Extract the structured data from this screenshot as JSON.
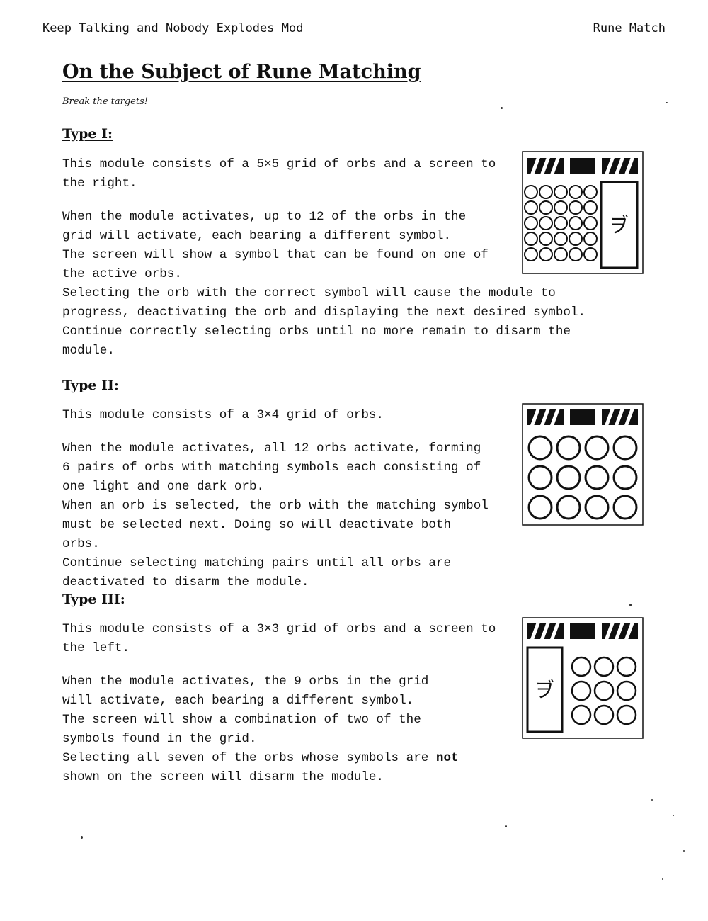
{
  "header": {
    "left": "Keep Talking and Nobody Explodes Mod",
    "right": "Rune Match"
  },
  "title": "On the Subject of Rune Matching",
  "flavor": "Break the targets!",
  "type1": {
    "heading": "Type I:",
    "intro": "This module consists of a 5×5 grid of orbs and a screen to the right.",
    "p1": "When the module activates, up to 12 of the orbs in the grid will activate, each bearing a different symbol.",
    "p2": "The screen will show a symbol that can be found on one of the active orbs.",
    "p3": "Selecting the orb with the correct symbol will cause the module to progress, deactivating the orb and displaying the next desired symbol.",
    "p4": "Continue correctly selecting orbs until no more remain to disarm the module.",
    "screen_symbol": "ヺ"
  },
  "type2": {
    "heading": "Type II:",
    "intro": "This module consists of a 3×4 grid of orbs.",
    "p1": "When the module activates, all 12 orbs activate, forming 6 pairs of orbs with matching symbols each consisting of one light and one dark orb.",
    "p2": "When an orb is selected, the orb with the matching symbol must be selected next. Doing so will deactivate both orbs.",
    "p3": "Continue selecting matching pairs until all orbs are deactivated to disarm the module."
  },
  "type3": {
    "heading": "Type III:",
    "intro": "This module consists of a 3×3 grid of orbs and a screen to the left.",
    "p1": "When the module activates, the 9 orbs in the grid will activate, each bearing a different symbol.",
    "p2": "The screen will show a combination of two of the symbols found in the grid.",
    "p3_before": "Selecting all seven of the orbs whose symbols are ",
    "p3_emph": "not",
    "p3_after": " shown on the screen will disarm the module.",
    "screen_symbol": "ヺ"
  }
}
